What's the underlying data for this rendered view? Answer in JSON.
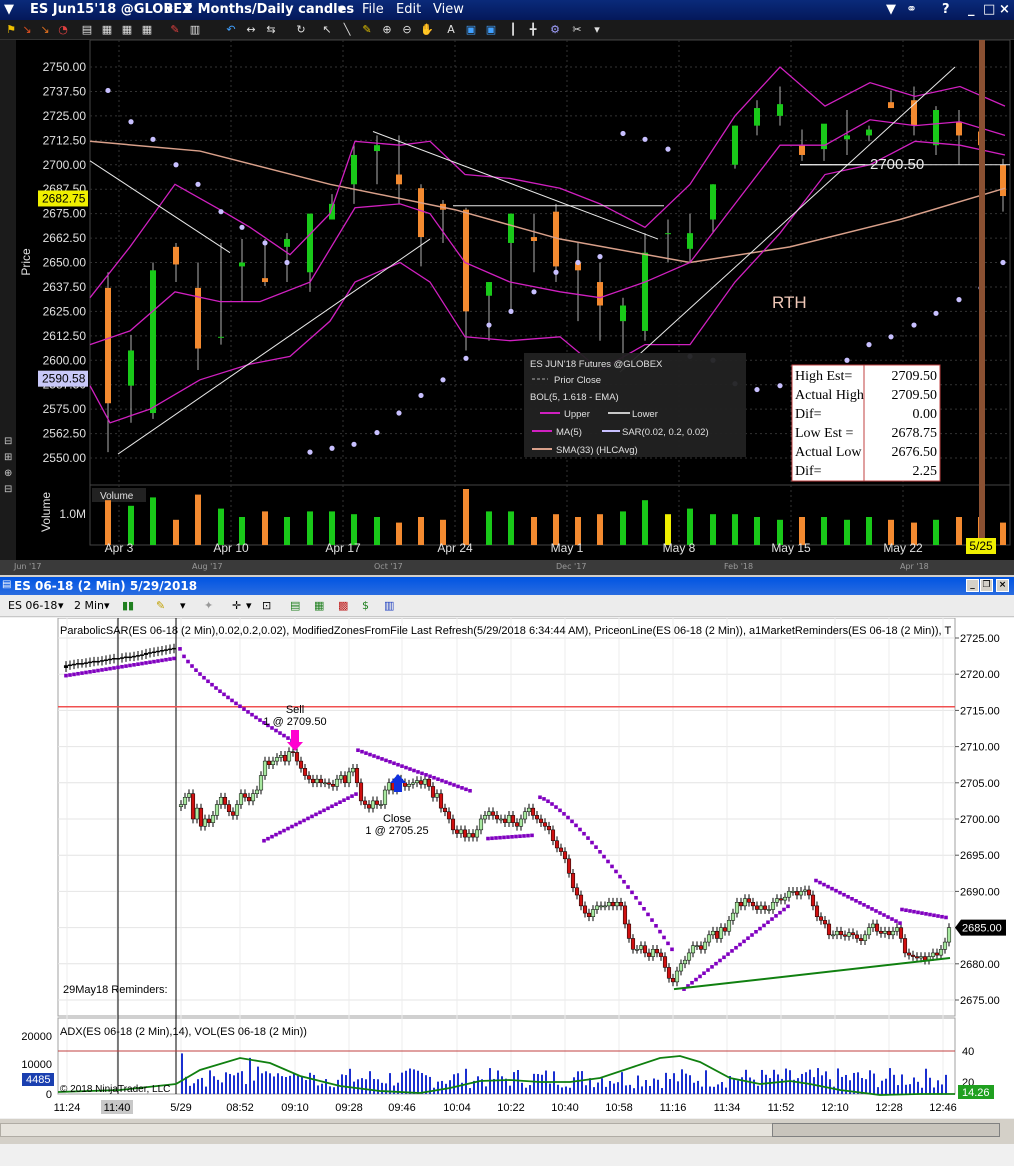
{
  "top_window": {
    "title": "ES Jun15'18 @GLOBEX",
    "period": "2 Months/Daily candles",
    "menu": [
      "File",
      "Edit",
      "View"
    ],
    "price_axis_label": "Price",
    "volume_axis_label": "Volume",
    "volume_panel_label": "Volume",
    "volume_tick": "1.0M",
    "y_ticks": [
      "2750.00",
      "2737.50",
      "2725.00",
      "2712.50",
      "2700.00",
      "2687.50",
      "2675.00",
      "2662.50",
      "2650.00",
      "2637.50",
      "2625.00",
      "2612.50",
      "2600.00",
      "2587.50",
      "2575.00",
      "2562.50",
      "2550.00"
    ],
    "price_badge_last": "2682.75",
    "price_badge_low": "2590.58",
    "x_labels": [
      "Apr 3",
      "Apr 10",
      "Apr 17",
      "Apr 24",
      "May 1",
      "May 8",
      "May 15",
      "May 22"
    ],
    "x_label_current": "5/25",
    "overview_labels": [
      "Jun '17",
      "Aug '17",
      "Oct '17",
      "Dec '17",
      "Feb '18",
      "Apr '18"
    ],
    "rth_label": "RTH",
    "level_label": "2700.50",
    "legend": {
      "title": "ES JUN'18 Futures @GLOBEX",
      "prior_close": "Prior Close",
      "bol": "BOL(5, 1.618 - EMA)",
      "upper": "Upper",
      "lower": "Lower",
      "ma": "MA(5)",
      "sar": "SAR(0.02, 0.2, 0.02)",
      "sma": "SMA(33) (HLCAvg)"
    },
    "estimates_table": [
      {
        "label": "High Est=",
        "value": "2709.50"
      },
      {
        "label": "Actual High",
        "value": "2709.50"
      },
      {
        "label": "Dif=",
        "value": "0.00"
      },
      {
        "label": "Low Est =",
        "value": "2678.75"
      },
      {
        "label": "Actual Low",
        "value": "2676.50"
      },
      {
        "label": "Dif=",
        "value": "2.25"
      }
    ]
  },
  "bottom_window": {
    "title": "ES 06-18 (2 Min)  5/29/2018",
    "instrument_select": "ES 06-18",
    "interval_select": "2 Min",
    "indicator_header": "ParabolicSAR(ES 06-18 (2 Min),0.02,0.2,0.02), ModifiedZonesFromFile Last Refresh(5/29/2018 6:34:44 AM), PriceonLine(ES 06-18 (2 Min)), a1MarketReminders(ES 06-18 (2 Min)), T",
    "reminders_label": "29May18 Reminders:",
    "sell_label": "Sell",
    "sell_detail": "1 @ 2709.50",
    "close_label": "Close",
    "close_detail": "1 @ 2705.25",
    "y_ticks": [
      "2725.00",
      "2720.00",
      "2715.00",
      "2710.00",
      "2705.00",
      "2700.00",
      "2695.00",
      "2690.00",
      "2685.00",
      "2680.00",
      "2675.00"
    ],
    "last_price_badge": "2685.00",
    "adx_header": "ADX(ES 06-18 (2 Min),14), VOL(ES 06-18 (2 Min))",
    "vol_ticks": [
      "20000",
      "10000",
      "0"
    ],
    "vol_badge": "4485",
    "adx_ticks": [
      "40",
      "20"
    ],
    "adx_badge": "14.26",
    "copyright": "© 2018 NinjaTrader, LLC",
    "x_labels": [
      "11:24",
      "11:40",
      "5/29",
      "08:52",
      "09:10",
      "09:28",
      "09:46",
      "10:04",
      "10:22",
      "10:40",
      "10:58",
      "11:16",
      "11:34",
      "11:52",
      "12:10",
      "12:28",
      "12:46"
    ]
  },
  "colors": {
    "bull_daily": "#19c919",
    "bear_daily": "#f38a30",
    "bollinger": "#d020c0",
    "sma33": "#d9a08a",
    "sar_daily": "#c8c0ff",
    "psar_intraday": "#8000c0",
    "zone_line": "#f05050",
    "trendline": "#108010"
  }
}
